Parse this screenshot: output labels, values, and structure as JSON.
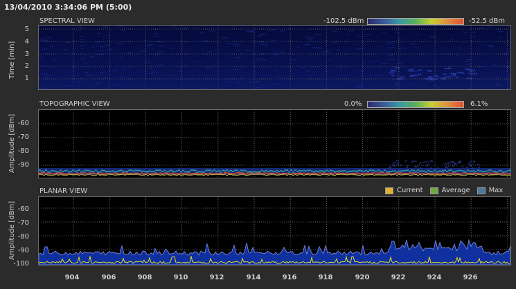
{
  "timestamp": "13/04/2010 3:34:06 PM (5:00)",
  "spectral": {
    "title": "SPECTRAL VIEW",
    "ylabel": "Time [min]",
    "yticks": [
      "5",
      "4",
      "3",
      "2",
      "1"
    ],
    "colorbar": {
      "min_label": "-102.5 dBm",
      "max_label": "-52.5 dBm"
    }
  },
  "topographic": {
    "title": "TOPOGRAPHIC VIEW",
    "ylabel": "Amplitude [dBm]",
    "yticks": [
      "-60",
      "-70",
      "-80",
      "-90"
    ],
    "colorbar": {
      "min_label": "0.0%",
      "max_label": "6.1%"
    }
  },
  "planar": {
    "title": "PLANAR VIEW",
    "ylabel": "Amplitude [dBm]",
    "yticks": [
      "-60",
      "-70",
      "-80",
      "-90",
      "-100"
    ],
    "legend": [
      {
        "label": "Current",
        "color": "#e0b030"
      },
      {
        "label": "Average",
        "color": "#70a840"
      },
      {
        "label": "Max",
        "color": "#4a7aa0"
      }
    ]
  },
  "xaxis": {
    "ticks": [
      "904",
      "906",
      "908",
      "910",
      "912",
      "914",
      "916",
      "918",
      "920",
      "922",
      "924",
      "926"
    ]
  },
  "colors": {
    "max_fill": "#1030a0",
    "max_line": "#7080d0",
    "current_line": "#e8e020",
    "background": "#2b2b2b"
  }
}
